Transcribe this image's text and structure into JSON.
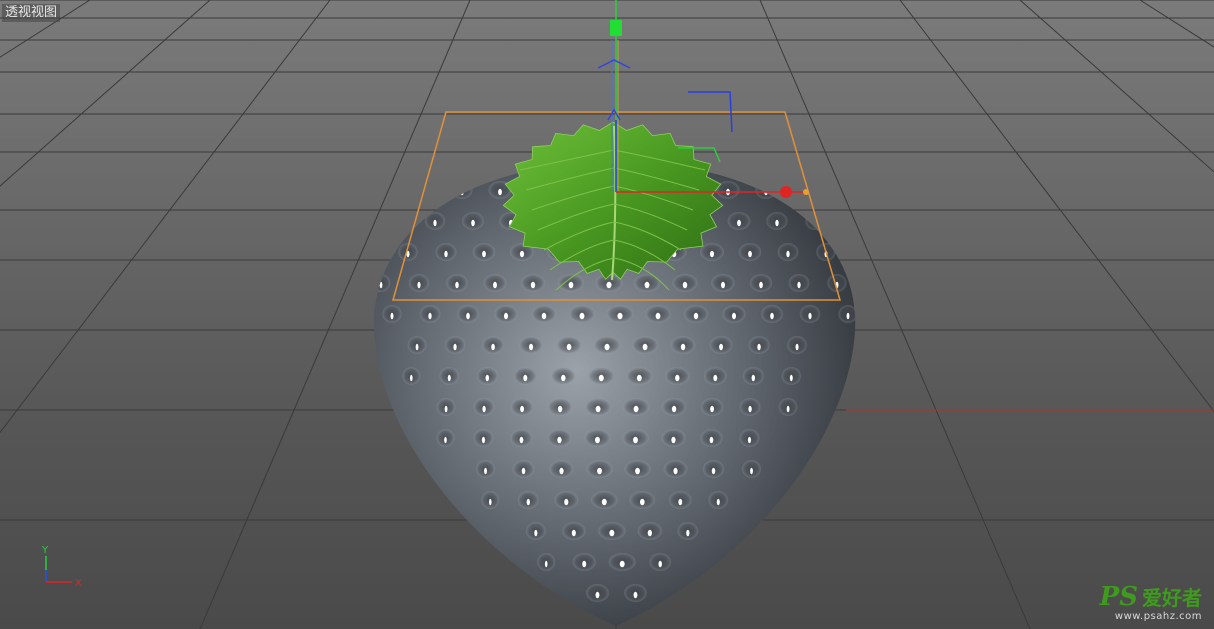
{
  "viewport": {
    "label": "透视视图",
    "bg_top": "#7b7b7b",
    "bg_bottom": "#4a4a4a",
    "grid_color": "#3a3a3a"
  },
  "object": {
    "name": "strawberry-body",
    "body_color": "#5a5f66",
    "seed_color": "#ffffff",
    "leaf_color": "#4e9a22",
    "selection_box_color": "#e0913a"
  },
  "gizmo": {
    "x_color": "#e02424",
    "y_color": "#2ecc40",
    "z_color": "#2a3fe0"
  },
  "axis_indicator": {
    "x": "X",
    "y": "Y"
  },
  "watermark": {
    "logo": "PS",
    "brand": "爱好者",
    "url": "www.psahz.com"
  }
}
